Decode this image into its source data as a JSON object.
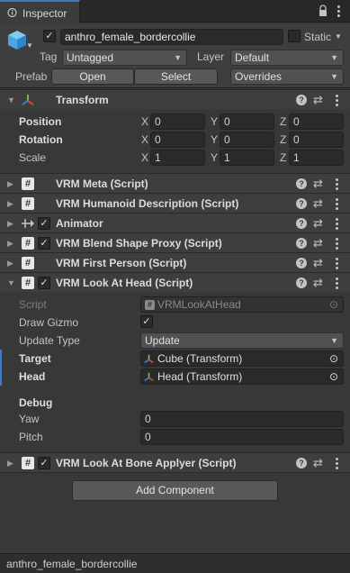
{
  "tab": {
    "title": "Inspector"
  },
  "object": {
    "active": true,
    "name": "anthro_female_bordercollie",
    "static_label": "Static",
    "static_checked": false,
    "tag_label": "Tag",
    "tag_value": "Untagged",
    "layer_label": "Layer",
    "layer_value": "Default",
    "prefab_label": "Prefab",
    "open_label": "Open",
    "select_label": "Select",
    "overrides_label": "Overrides"
  },
  "transform": {
    "title": "Transform",
    "position": {
      "label": "Position",
      "x": "0",
      "y": "0",
      "z": "0"
    },
    "rotation": {
      "label": "Rotation",
      "x": "0",
      "y": "0",
      "z": "0"
    },
    "scale": {
      "label": "Scale",
      "x": "1",
      "y": "1",
      "z": "1"
    },
    "axis": {
      "x": "X",
      "y": "Y",
      "z": "Z"
    }
  },
  "components": [
    {
      "title": "VRM Meta (Script)"
    },
    {
      "title": "VRM Humanoid Description (Script)"
    },
    {
      "title": "Animator"
    },
    {
      "title": "VRM Blend Shape Proxy (Script)"
    },
    {
      "title": "VRM First Person (Script)"
    },
    {
      "title": "VRM Look At Head (Script)"
    }
  ],
  "lookat": {
    "script_label": "Script",
    "script_value": "VRMLookAtHead",
    "draw_gizmo_label": "Draw Gizmo",
    "draw_gizmo_checked": true,
    "update_type_label": "Update Type",
    "update_type_value": "Update",
    "target_label": "Target",
    "target_value": "Cube (Transform)",
    "head_label": "Head",
    "head_value": "Head (Transform)",
    "debug_label": "Debug",
    "yaw_label": "Yaw",
    "yaw_value": "0",
    "pitch_label": "Pitch",
    "pitch_value": "0"
  },
  "applyer": {
    "title": "VRM Look At Bone Applyer (Script)"
  },
  "add_component_label": "Add Component",
  "status": {
    "text": "anthro_female_bordercollie"
  },
  "icons": {
    "help": "?",
    "preset": "⇄",
    "check": "✓",
    "hash": "#",
    "fold_open": "▼",
    "fold_closed": "▶",
    "dropdown": "▼",
    "target": "⊙"
  }
}
